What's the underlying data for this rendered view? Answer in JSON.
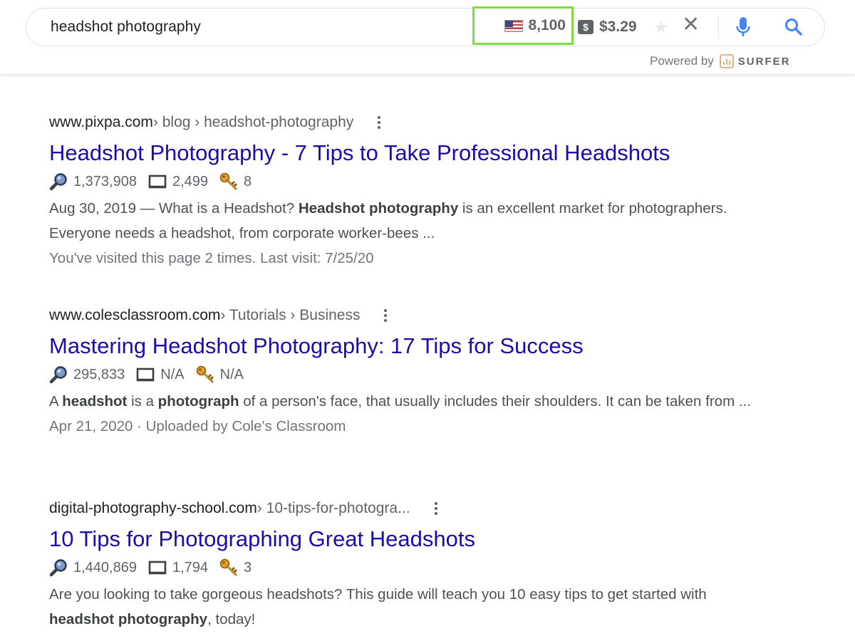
{
  "search": {
    "query": "headshot photography",
    "volume": "8,100",
    "cpc": "$3.29",
    "dollar_symbol": "$",
    "powered_by_label": "Powered by",
    "powered_by_brand": "SURFER"
  },
  "colors": {
    "link": "#1a0dab",
    "highlight_border": "#7be03c",
    "mic": "#4285f4",
    "key_icon": "#e2a02b"
  },
  "results": [
    {
      "domain": "www.pixpa.com",
      "breadcrumbs": " › blog › headshot-photography",
      "title": "Headshot Photography - 7 Tips to Take Professional Headshots",
      "traffic": "1,373,908",
      "words": "2,499",
      "keywords": "8",
      "snippet_parts": [
        "Aug 30, 2019 — What is a Headshot? ",
        "Headshot photography",
        " is an excellent market for photographers. Everyone needs a headshot, from corporate worker-bees ..."
      ],
      "visited": "You've visited this page 2 times. Last visit: 7/25/20"
    },
    {
      "domain": "www.colesclassroom.com",
      "breadcrumbs": " › Tutorials › Business",
      "title": "Mastering Headshot Photography: 17 Tips for Success",
      "traffic": "295,833",
      "words": "N/A",
      "keywords": "N/A",
      "snippet_parts": [
        "A ",
        "headshot",
        " is a ",
        "photograph",
        " of a person's face, that usually includes their shoulders. It can be taken from ..."
      ],
      "visited": "Apr 21, 2020 · Uploaded by Cole's Classroom"
    },
    {
      "domain": "digital-photography-school.com",
      "breadcrumbs": " › 10-tips-for-photogra...",
      "title": "10 Tips for Photographing Great Headshots",
      "traffic": "1,440,869",
      "words": "1,794",
      "keywords": "3",
      "snippet_parts": [
        "Are you looking to take gorgeous headshots? This guide will teach you 10 easy tips to get started with ",
        "headshot photography",
        ", today!"
      ]
    }
  ]
}
